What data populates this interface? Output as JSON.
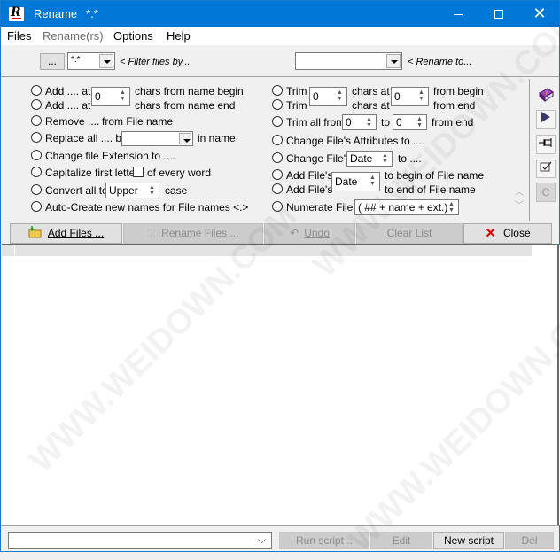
{
  "window": {
    "title": "Rename",
    "title_suffix": "*.*",
    "controls": {
      "minimize": "minimize",
      "maximize": "maximize",
      "close": "close"
    }
  },
  "menu": [
    {
      "label": "Files",
      "enabled": true
    },
    {
      "label": "Rename(rs)",
      "enabled": false
    },
    {
      "label": "Options",
      "enabled": true
    },
    {
      "label": "Help",
      "enabled": true
    }
  ],
  "toolbar": {
    "browse_label": "...",
    "filter_value": "*.*",
    "filter_hint": "< Filter files by...",
    "rename_to_value": "",
    "rename_to_hint": "< Rename to..."
  },
  "options_left": {
    "add_begin": {
      "pre": "Add .... at",
      "post": "chars from name begin"
    },
    "add_end": {
      "pre": "Add .... at",
      "post": "chars from name end"
    },
    "add_spin_value": "0",
    "remove": {
      "pre": "Remove  ....",
      "post": "from File name"
    },
    "replace": {
      "pre": "Replace all .... by",
      "value": "",
      "post": "in name"
    },
    "change_ext": "Change file Extension to ....",
    "capitalize": {
      "pre": "Capitalize first letter",
      "post": "of every word",
      "checked": false
    },
    "convert": {
      "pre": "Convert all to",
      "value": "Upper",
      "post": "case"
    },
    "auto_create": "Auto-Create new names for File names <.>"
  },
  "options_right": {
    "trim_begin": {
      "pre": "Trim",
      "mid": "chars at",
      "post": "from begin"
    },
    "trim_end": {
      "pre": "Trim",
      "mid": "chars at",
      "post": "from  end"
    },
    "trim_spin1": "0",
    "trim_spin2": "0",
    "trim_all": {
      "pre": "Trim all from",
      "from": "0",
      "to_label": "to",
      "to": "0",
      "post": "from end"
    },
    "change_attr": "Change File's Attributes to  ....",
    "change_file": {
      "pre": "Change File's",
      "value": "Date",
      "post": "to  ...."
    },
    "add_file_begin": {
      "pre": "Add File's",
      "post": "to begin of File name"
    },
    "add_file_end": {
      "pre": "Add File's",
      "post": "to end of File name"
    },
    "add_file_value": "Date",
    "numerate": {
      "pre": "Numerate Files",
      "value": "( ## + name + ext.)"
    }
  },
  "side_buttons": [
    {
      "name": "help-book",
      "icon": "book-icon",
      "enabled": true
    },
    {
      "name": "run",
      "icon": "play-icon",
      "enabled": true
    },
    {
      "name": "pin",
      "icon": "pin-icon",
      "enabled": true
    },
    {
      "name": "check",
      "icon": "checkbox-icon",
      "enabled": true
    },
    {
      "name": "copy",
      "icon": "c-icon",
      "glyph": "C",
      "enabled": false
    }
  ],
  "actions": {
    "add_files": "Add Files ...",
    "rename_files": "Rename Files ...",
    "undo": "Undo",
    "clear_list": "Clear List",
    "close": "Close"
  },
  "script_bar": {
    "script_value": "",
    "run_script": "Run script ..",
    "edit": "Edit",
    "new_script": "New script",
    "del": "Del"
  },
  "watermark": "WWW.WEIDOWN.COM"
}
